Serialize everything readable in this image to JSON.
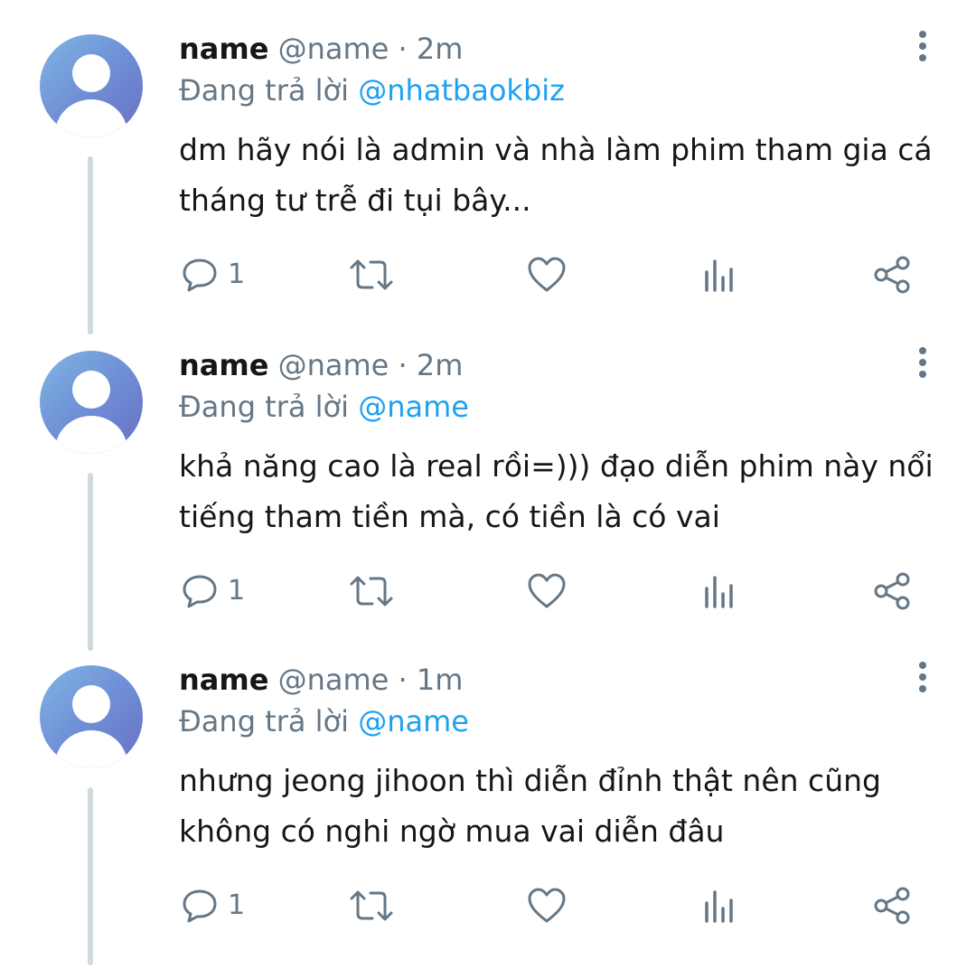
{
  "tweets": [
    {
      "display_name": "name",
      "handle": "@name",
      "separator": "·",
      "time": "2m",
      "reply_prefix": "Đang trả lời",
      "reply_to": "@nhatbaokbiz",
      "text": "dm hãy nói là admin và nhà làm phim tham gia cá tháng tư trễ đi tụi bây...",
      "reply_count": "1"
    },
    {
      "display_name": "name",
      "handle": "@name",
      "separator": "·",
      "time": "2m",
      "reply_prefix": "Đang trả lời",
      "reply_to": "@name",
      "text": "khả năng cao là real rồi=))) đạo diễn phim này nổi tiếng tham tiền mà, có tiền là có vai",
      "reply_count": "1"
    },
    {
      "display_name": "name",
      "handle": "@name",
      "separator": "·",
      "time": "1m",
      "reply_prefix": "Đang trả lời",
      "reply_to": "@name",
      "text": "nhưng jeong jihoon thì diễn đỉnh thật nên cũng không có nghi ngờ mua vai diễn đâu",
      "reply_count": "1"
    }
  ],
  "icons": {
    "reply": "speech-bubble-icon",
    "retweet": "retweet-icon",
    "like": "heart-icon",
    "views": "bar-chart-icon",
    "share": "share-icon",
    "more": "vertical-dots-icon",
    "avatar": "default-user-icon"
  },
  "colors": {
    "text": "#14171a",
    "secondary": "#657786",
    "mention": "#1da1f2",
    "thread_line": "#cfd9de"
  }
}
